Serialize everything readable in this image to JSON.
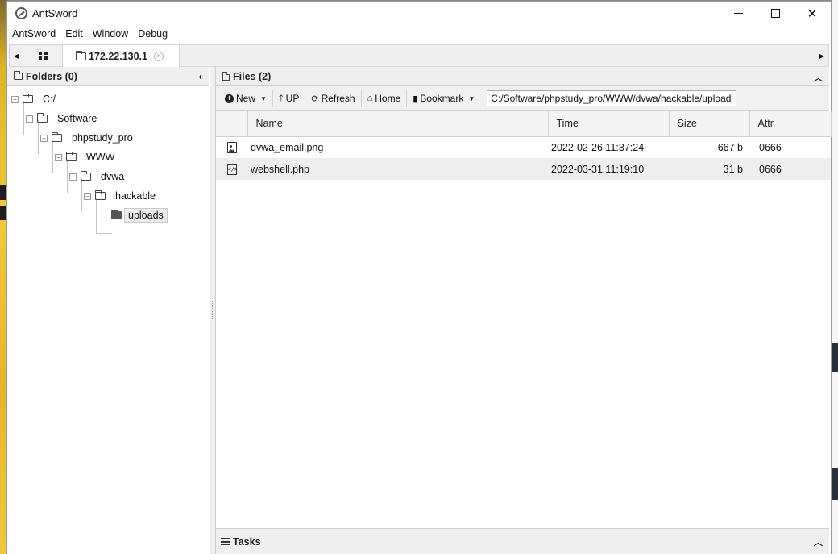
{
  "window": {
    "title": "AntSword"
  },
  "menu": [
    "AntSword",
    "Edit",
    "Window",
    "Debug"
  ],
  "tabs": {
    "active_label": "172.22.130.1"
  },
  "folders_panel": {
    "title": "Folders (0)",
    "tree": [
      {
        "label": "C:/"
      },
      {
        "label": "Software"
      },
      {
        "label": "phpstudy_pro"
      },
      {
        "label": "WWW"
      },
      {
        "label": "dvwa"
      },
      {
        "label": "hackable"
      },
      {
        "label": "uploads"
      }
    ]
  },
  "files_panel": {
    "title": "Files (2)",
    "toolbar": {
      "new_label": "New",
      "up_label": "UP",
      "refresh_label": "Refresh",
      "home_label": "Home",
      "bookmark_label": "Bookmark",
      "path_value": "C:/Software/phpstudy_pro/WWW/dvwa/hackable/uploads/"
    },
    "columns": [
      "Name",
      "Time",
      "Size",
      "Attr"
    ],
    "rows": [
      {
        "icon": "image-file-icon",
        "name": "dvwa_email.png",
        "time": "2022-02-26 11:37:24",
        "size": "667 b",
        "attr": "0666"
      },
      {
        "icon": "code-file-icon",
        "name": "webshell.php",
        "time": "2022-03-31 11:19:10",
        "size": "31 b",
        "attr": "0666"
      }
    ]
  },
  "tasks": {
    "title": "Tasks"
  }
}
